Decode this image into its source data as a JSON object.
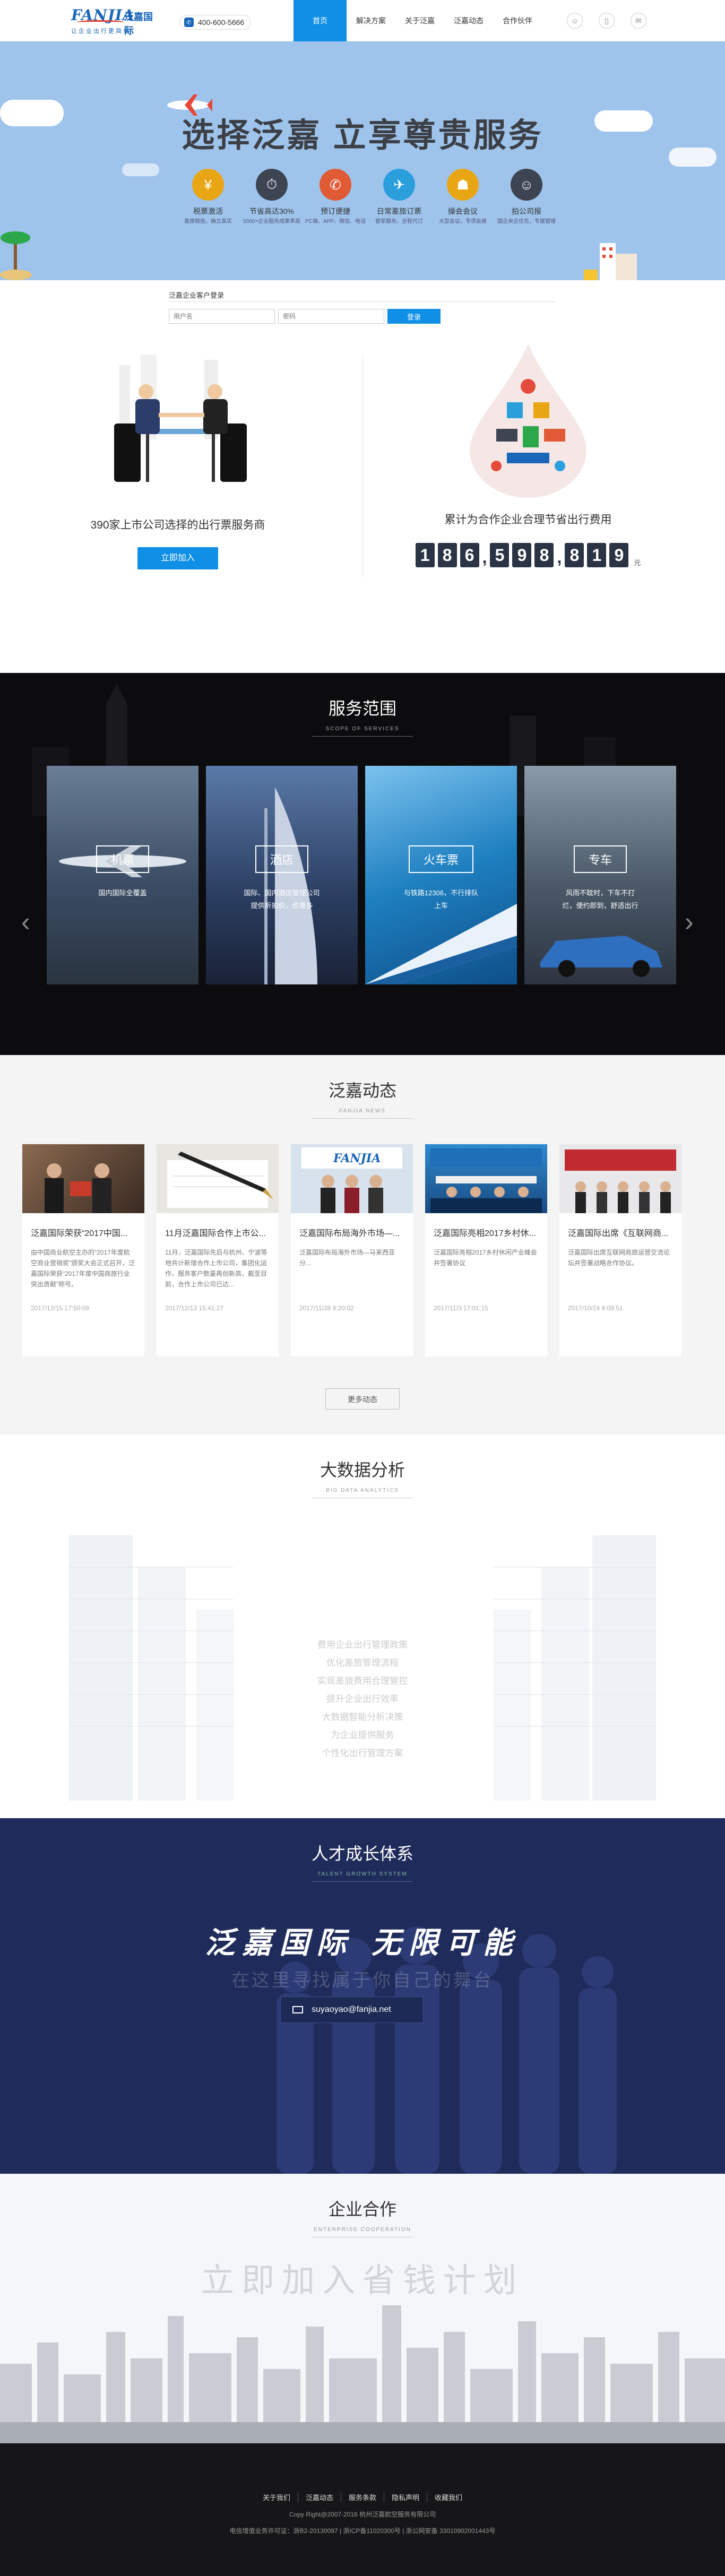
{
  "header": {
    "logo_en": "FANJIA",
    "logo_cn": "泛嘉国际",
    "logo_slogan": "让企业出行更简单",
    "phone": "400-600-5666",
    "nav": [
      "首页",
      "解决方案",
      "关于泛嘉",
      "泛嘉动态",
      "合作伙伴"
    ],
    "icons": [
      "user-icon",
      "mobile-icon",
      "wechat-icon"
    ]
  },
  "banner": {
    "title": "选择泛嘉  立享尊贵服务",
    "features": [
      {
        "title": "税票激活",
        "desc": "差旅税抵，确立真实",
        "color": "#e9a614",
        "icon": "¥"
      },
      {
        "title": "节省高达30%",
        "desc": "5000+企业服务成果率高",
        "color": "#3d4452",
        "icon": "⏱"
      },
      {
        "title": "预订便捷",
        "desc": "PC端、APP、微信、电话",
        "color": "#e05a35",
        "icon": "✆"
      },
      {
        "title": "日常差旅订票",
        "desc": "管家服务，全程代订",
        "color": "#2a9fdc",
        "icon": "✈"
      },
      {
        "title": "操会会议",
        "desc": "大型会议，专项会展",
        "color": "#e9a614",
        "icon": "☗"
      },
      {
        "title": "拍公司报",
        "desc": "国企央企优先，专属管理",
        "color": "#3d4452",
        "icon": "☺"
      }
    ]
  },
  "login": {
    "title": "泛嘉企业客户登录",
    "user_placeholder": "用户名",
    "pwd_placeholder": "密码",
    "btn": "登录"
  },
  "clients": {
    "left_caption": "390家上市公司选择的出行票服务商",
    "left_button": "立即加入",
    "right_caption": "累计为合作企业合理节省出行费用",
    "counter": [
      "1",
      "8",
      "6",
      ",",
      "5",
      "9",
      "8",
      ",",
      "8",
      "1",
      "9"
    ],
    "unit": "元"
  },
  "services": {
    "title": "服务范围",
    "subtitle": "SCOPE OF SERVICES",
    "cards": [
      {
        "label": "机票",
        "desc": "国内国际全覆盖",
        "bg": "#3a4c64"
      },
      {
        "label": "酒店",
        "desc": "国际、国内酒店管理公司提供折扣价，优惠多",
        "bg": "#2a3d60"
      },
      {
        "label": "火车票",
        "desc": "与铁路12306，不行排队上车",
        "bg": "#1e7fc0"
      },
      {
        "label": "专车",
        "desc": "风雨不耽时，下车不打烂，便约即到，舒适出行",
        "bg": "#4a5868"
      }
    ]
  },
  "news": {
    "title": "泛嘉动态",
    "subtitle": "FANJIA NEWS",
    "items": [
      {
        "title": "泛嘉国际荣获“2017中国...",
        "text": "由中国商业航空主办的“2017年度航空商业营销奖”颁奖大会正式召开，泛嘉国际荣获“2017年度中国商旅行业突出贡献”称号。",
        "date": "2017/12/15 17:50:09",
        "bg": "#5a4030"
      },
      {
        "title": "11月泛嘉国际合作上市公...",
        "text": "11月，泛嘉国际先后与杭州、宁波等地共计新增合作上市公司，集团化运作，服务客户数量再创新高，截至目前，合作上市公司已达...",
        "date": "2017/12/13 15:41:27",
        "bg": "#d4d2cc"
      },
      {
        "title": "泛嘉国际布局海外市场—...",
        "text": "泛嘉国际布局海外市场—马来西亚分...",
        "date": "2017/11/28 9:20:02",
        "bg": "#8ca0b4"
      },
      {
        "title": "泛嘉国际亮相2017乡村休...",
        "text": "泛嘉国际亮相2017乡村休闲产业峰会并签署协议",
        "date": "2017/11/3 17:01:15",
        "bg": "#2a6aa4"
      },
      {
        "title": "泛嘉国际出席《互联网商...",
        "text": "泛嘉国际出席互联网商旅运营交流论坛并签署战略合作协议。",
        "date": "2017/10/24 9:09:51",
        "bg": "#b03238"
      }
    ],
    "more": "更多动态"
  },
  "bigdata": {
    "title": "大数据分析",
    "subtitle": "BIG DATA ANALYTICS",
    "list": [
      "费用企业出行管理政策",
      "优化差旅管理流程",
      "实现差旅费用合理管控",
      "提升企业出行效率",
      "大数据智能分析决策",
      "为企业提供服务",
      "个性化出行管理方案"
    ]
  },
  "talent": {
    "title": "人才成长体系",
    "subtitle": "TALENT GROWTH SYSTEM",
    "slogan": "泛嘉国际  无限可能",
    "sub": "在这里寻找属于你自己的舞台",
    "email": "suyaoyao@fanjia.net"
  },
  "coop": {
    "title": "企业合作",
    "subtitle": "ENTERPRISE COOPERATION",
    "banner": "立即加入省钱计划"
  },
  "footer": {
    "links": [
      "关于我们",
      "泛嘉动态",
      "服务条款",
      "隐私声明",
      "收藏我们"
    ],
    "copyright": "Copy Right@2007-2016 杭州泛嘉航空服务有限公司",
    "icp": "电信增值业务许可证：浙B2-20130097 | 浙ICP备11020300号 | 浙公网安备 33010902001443号"
  }
}
